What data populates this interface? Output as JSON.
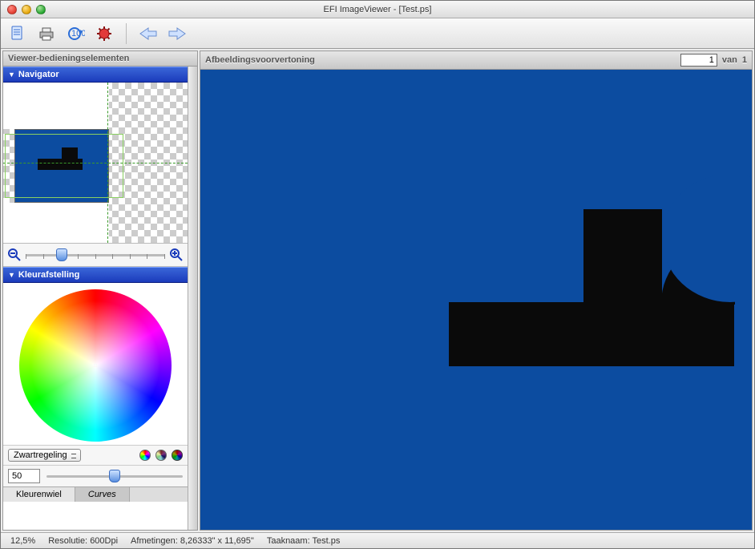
{
  "window": {
    "title": "EFI ImageViewer - [Test.ps]"
  },
  "left_panel": {
    "title": "Viewer-bedieningselementen",
    "navigator_label": "Navigator",
    "color_section_label": "Kleurafstelling",
    "combo_value": "Zwartregeling",
    "brightness_value": "50",
    "tabs": {
      "wheel": "Kleurenwiel",
      "curves": "Curves"
    }
  },
  "preview": {
    "title": "Afbeeldingsvoorvertoning",
    "page_current": "1",
    "page_of_label": "van",
    "page_total": "1"
  },
  "status": {
    "zoom": "12,5%",
    "res_label": "Resolutie:",
    "res_value": "600Dpi",
    "dim_label": "Afmetingen:",
    "dim_value": "8,26333\" x 11,695\"",
    "job_label": "Taaknaam:",
    "job_value": "Test.ps"
  }
}
